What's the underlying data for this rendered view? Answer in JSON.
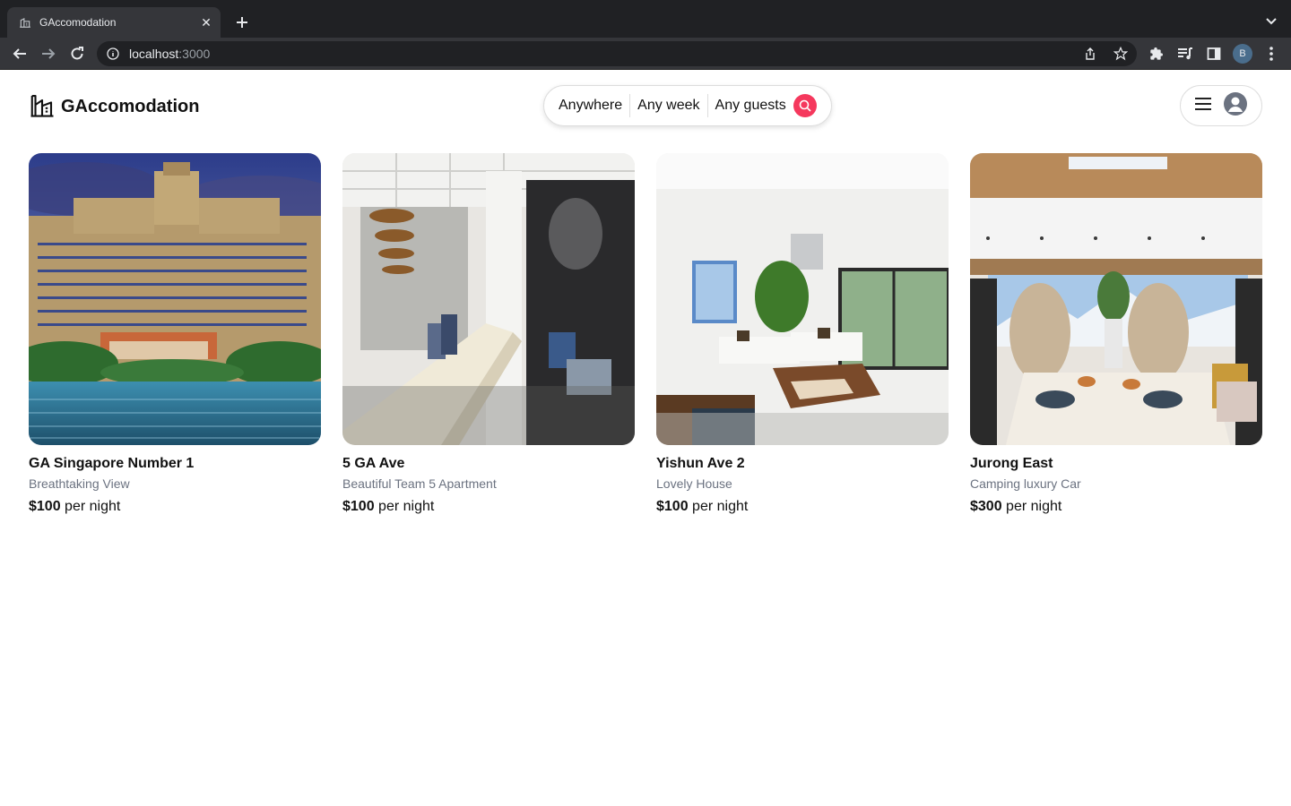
{
  "browser": {
    "tab_title": "GAccomodation",
    "url_host": "localhost",
    "url_port": ":3000",
    "profile_initial": "B"
  },
  "header": {
    "logo_text": "GAccomodation",
    "search": {
      "where": "Anywhere",
      "when": "Any week",
      "who": "Any guests"
    }
  },
  "colors": {
    "accent": "#f5385d"
  },
  "listings": [
    {
      "title": "GA Singapore Number 1",
      "subtitle": "Breathtaking View",
      "price": "$100",
      "unit": "per night"
    },
    {
      "title": "5 GA Ave",
      "subtitle": "Beautiful Team 5 Apartment",
      "price": "$100",
      "unit": "per night"
    },
    {
      "title": "Yishun Ave 2",
      "subtitle": "Lovely House",
      "price": "$100",
      "unit": "per night"
    },
    {
      "title": "Jurong East",
      "subtitle": "Camping luxury Car",
      "price": "$300",
      "unit": "per night"
    }
  ]
}
